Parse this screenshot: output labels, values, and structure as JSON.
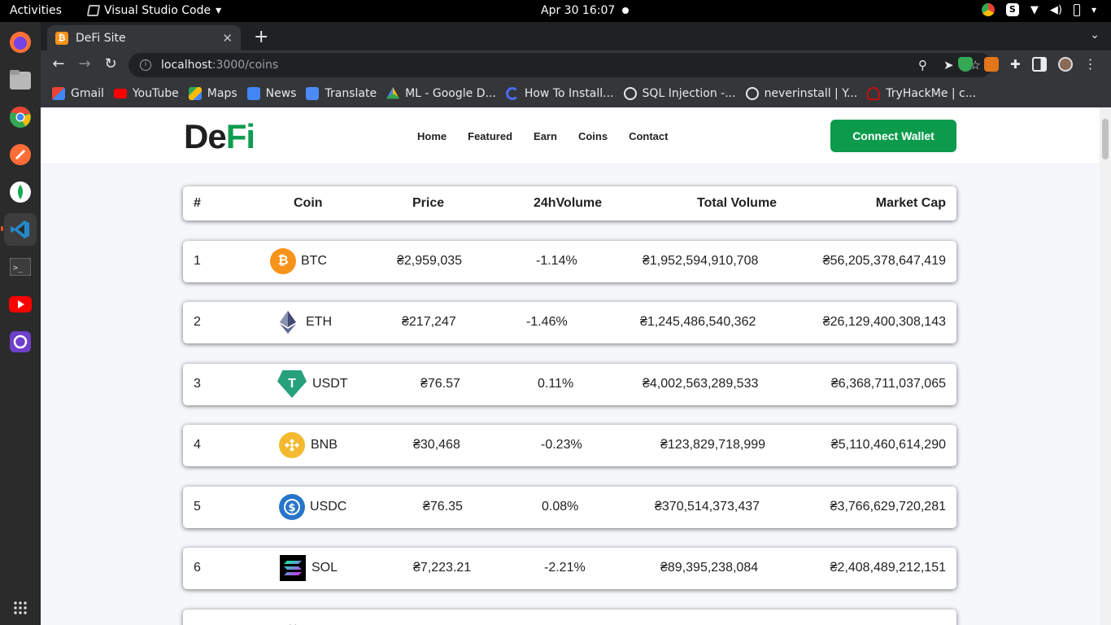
{
  "system": {
    "activities": "Activities",
    "app_name": "Visual Studio Code",
    "clock": "Apr 30  16:07"
  },
  "browser": {
    "tab_title": "DeFi Site",
    "url_host": "localhost",
    "url_path": ":3000/coins",
    "bookmarks": [
      "Gmail",
      "YouTube",
      "Maps",
      "News",
      "Translate",
      "ML - Google D...",
      "How To Install...",
      "SQL Injection -...",
      "neverinstall | Y...",
      "TryHackMe | c..."
    ]
  },
  "site": {
    "logo_de": "De",
    "logo_fi": "Fi",
    "nav": [
      "Home",
      "Featured",
      "Earn",
      "Coins",
      "Contact"
    ],
    "connect_label": "Connect Wallet"
  },
  "table": {
    "headers": [
      "#",
      "Coin",
      "Price",
      "24hVolume",
      "Total Volume",
      "Market Cap"
    ],
    "rows": [
      {
        "rank": "1",
        "symbol": "BTC",
        "price": "₴2,959,035",
        "change": "-1.14%",
        "total_volume": "₴1,952,594,910,708",
        "market_cap": "₴56,205,378,647,419",
        "icon": "btc-icon",
        "color": "#f7931a"
      },
      {
        "rank": "2",
        "symbol": "ETH",
        "price": "₴217,247",
        "change": "-1.46%",
        "total_volume": "₴1,245,486,540,362",
        "market_cap": "₴26,129,400,308,143",
        "icon": "eth-icon",
        "color": "#454a75"
      },
      {
        "rank": "3",
        "symbol": "USDT",
        "price": "₴76.57",
        "change": "0.11%",
        "total_volume": "₴4,002,563,289,533",
        "market_cap": "₴6,368,711,037,065",
        "icon": "usdt-icon",
        "color": "#26a17b"
      },
      {
        "rank": "4",
        "symbol": "BNB",
        "price": "₴30,468",
        "change": "-0.23%",
        "total_volume": "₴123,829,718,999",
        "market_cap": "₴5,110,460,614,290",
        "icon": "bnb-icon",
        "color": "#f3ba2f"
      },
      {
        "rank": "5",
        "symbol": "USDC",
        "price": "₴76.35",
        "change": "0.08%",
        "total_volume": "₴370,514,373,437",
        "market_cap": "₴3,766,629,720,281",
        "icon": "usdc-icon",
        "color": "#2775ca"
      },
      {
        "rank": "6",
        "symbol": "SOL",
        "price": "₴7,223.21",
        "change": "-2.21%",
        "total_volume": "₴89,395,238,084",
        "market_cap": "₴2,408,489,212,151",
        "icon": "sol-icon",
        "color": "#000000"
      }
    ]
  }
}
